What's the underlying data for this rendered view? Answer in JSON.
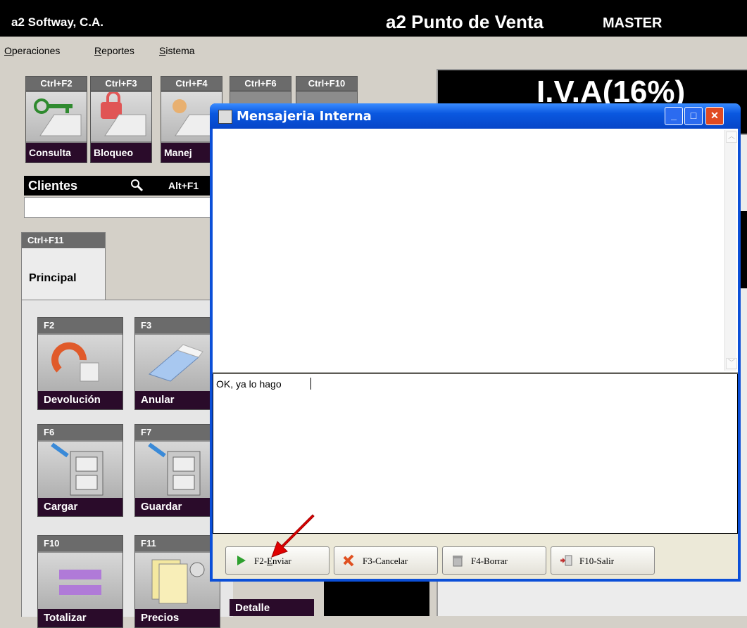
{
  "app": {
    "company": "a2 Softway, C.A.",
    "title": "a2 Punto de Venta",
    "user": "MASTER"
  },
  "menu": [
    {
      "label": "Operaciones",
      "mnemonic": "O"
    },
    {
      "label": "Reportes",
      "mnemonic": "R"
    },
    {
      "label": "Sistema",
      "mnemonic": "S"
    }
  ],
  "toolbar": [
    {
      "key": "Ctrl+F2",
      "label": "Consulta",
      "icon": "key-icon"
    },
    {
      "key": "Ctrl+F3",
      "label": "Bloqueo",
      "icon": "lock-icon"
    },
    {
      "key": "Ctrl+F4",
      "label": "Manej",
      "icon": "hand-icon"
    },
    {
      "key": "Ctrl+F6",
      "label": "",
      "icon": "tool-icon"
    },
    {
      "key": "Ctrl+F10",
      "label": "",
      "icon": "tool-icon"
    }
  ],
  "clientes": {
    "label": "Clientes",
    "key": "Alt+F1",
    "value": ""
  },
  "tab": {
    "key": "Ctrl+F11",
    "label": "Principal"
  },
  "functions": [
    {
      "key": "F2",
      "label": "Devolución",
      "icon": "return-icon"
    },
    {
      "key": "F3",
      "label": "Anular",
      "icon": "eraser-icon"
    },
    {
      "key": "F6",
      "label": "Cargar",
      "icon": "cabinet-load-icon"
    },
    {
      "key": "F7",
      "label": "Guardar",
      "icon": "cabinet-save-icon"
    },
    {
      "key": "F10",
      "label": "Totalizar",
      "icon": "equals-icon"
    },
    {
      "key": "F11",
      "label": "Precios",
      "icon": "price-list-icon"
    },
    {
      "label": "Detalle"
    }
  ],
  "display": {
    "text": "I.V.A(16%)"
  },
  "dialog": {
    "title": "Mensajeria Interna",
    "messages": "",
    "input_value": "OK, ya lo hago",
    "buttons": [
      {
        "label": "F2-Enviar",
        "mnemonic": "E",
        "icon": "play-icon"
      },
      {
        "label": "F3-Cancelar",
        "icon": "x-icon"
      },
      {
        "label": "F4-Borrar",
        "icon": "trash-icon"
      },
      {
        "label": "F10-Salir",
        "icon": "exit-icon"
      }
    ]
  },
  "colors": {
    "dialog_frame": "#0b4fd8",
    "label_bg": "#2a0b2a",
    "annotation_arrow": "#e00000"
  }
}
